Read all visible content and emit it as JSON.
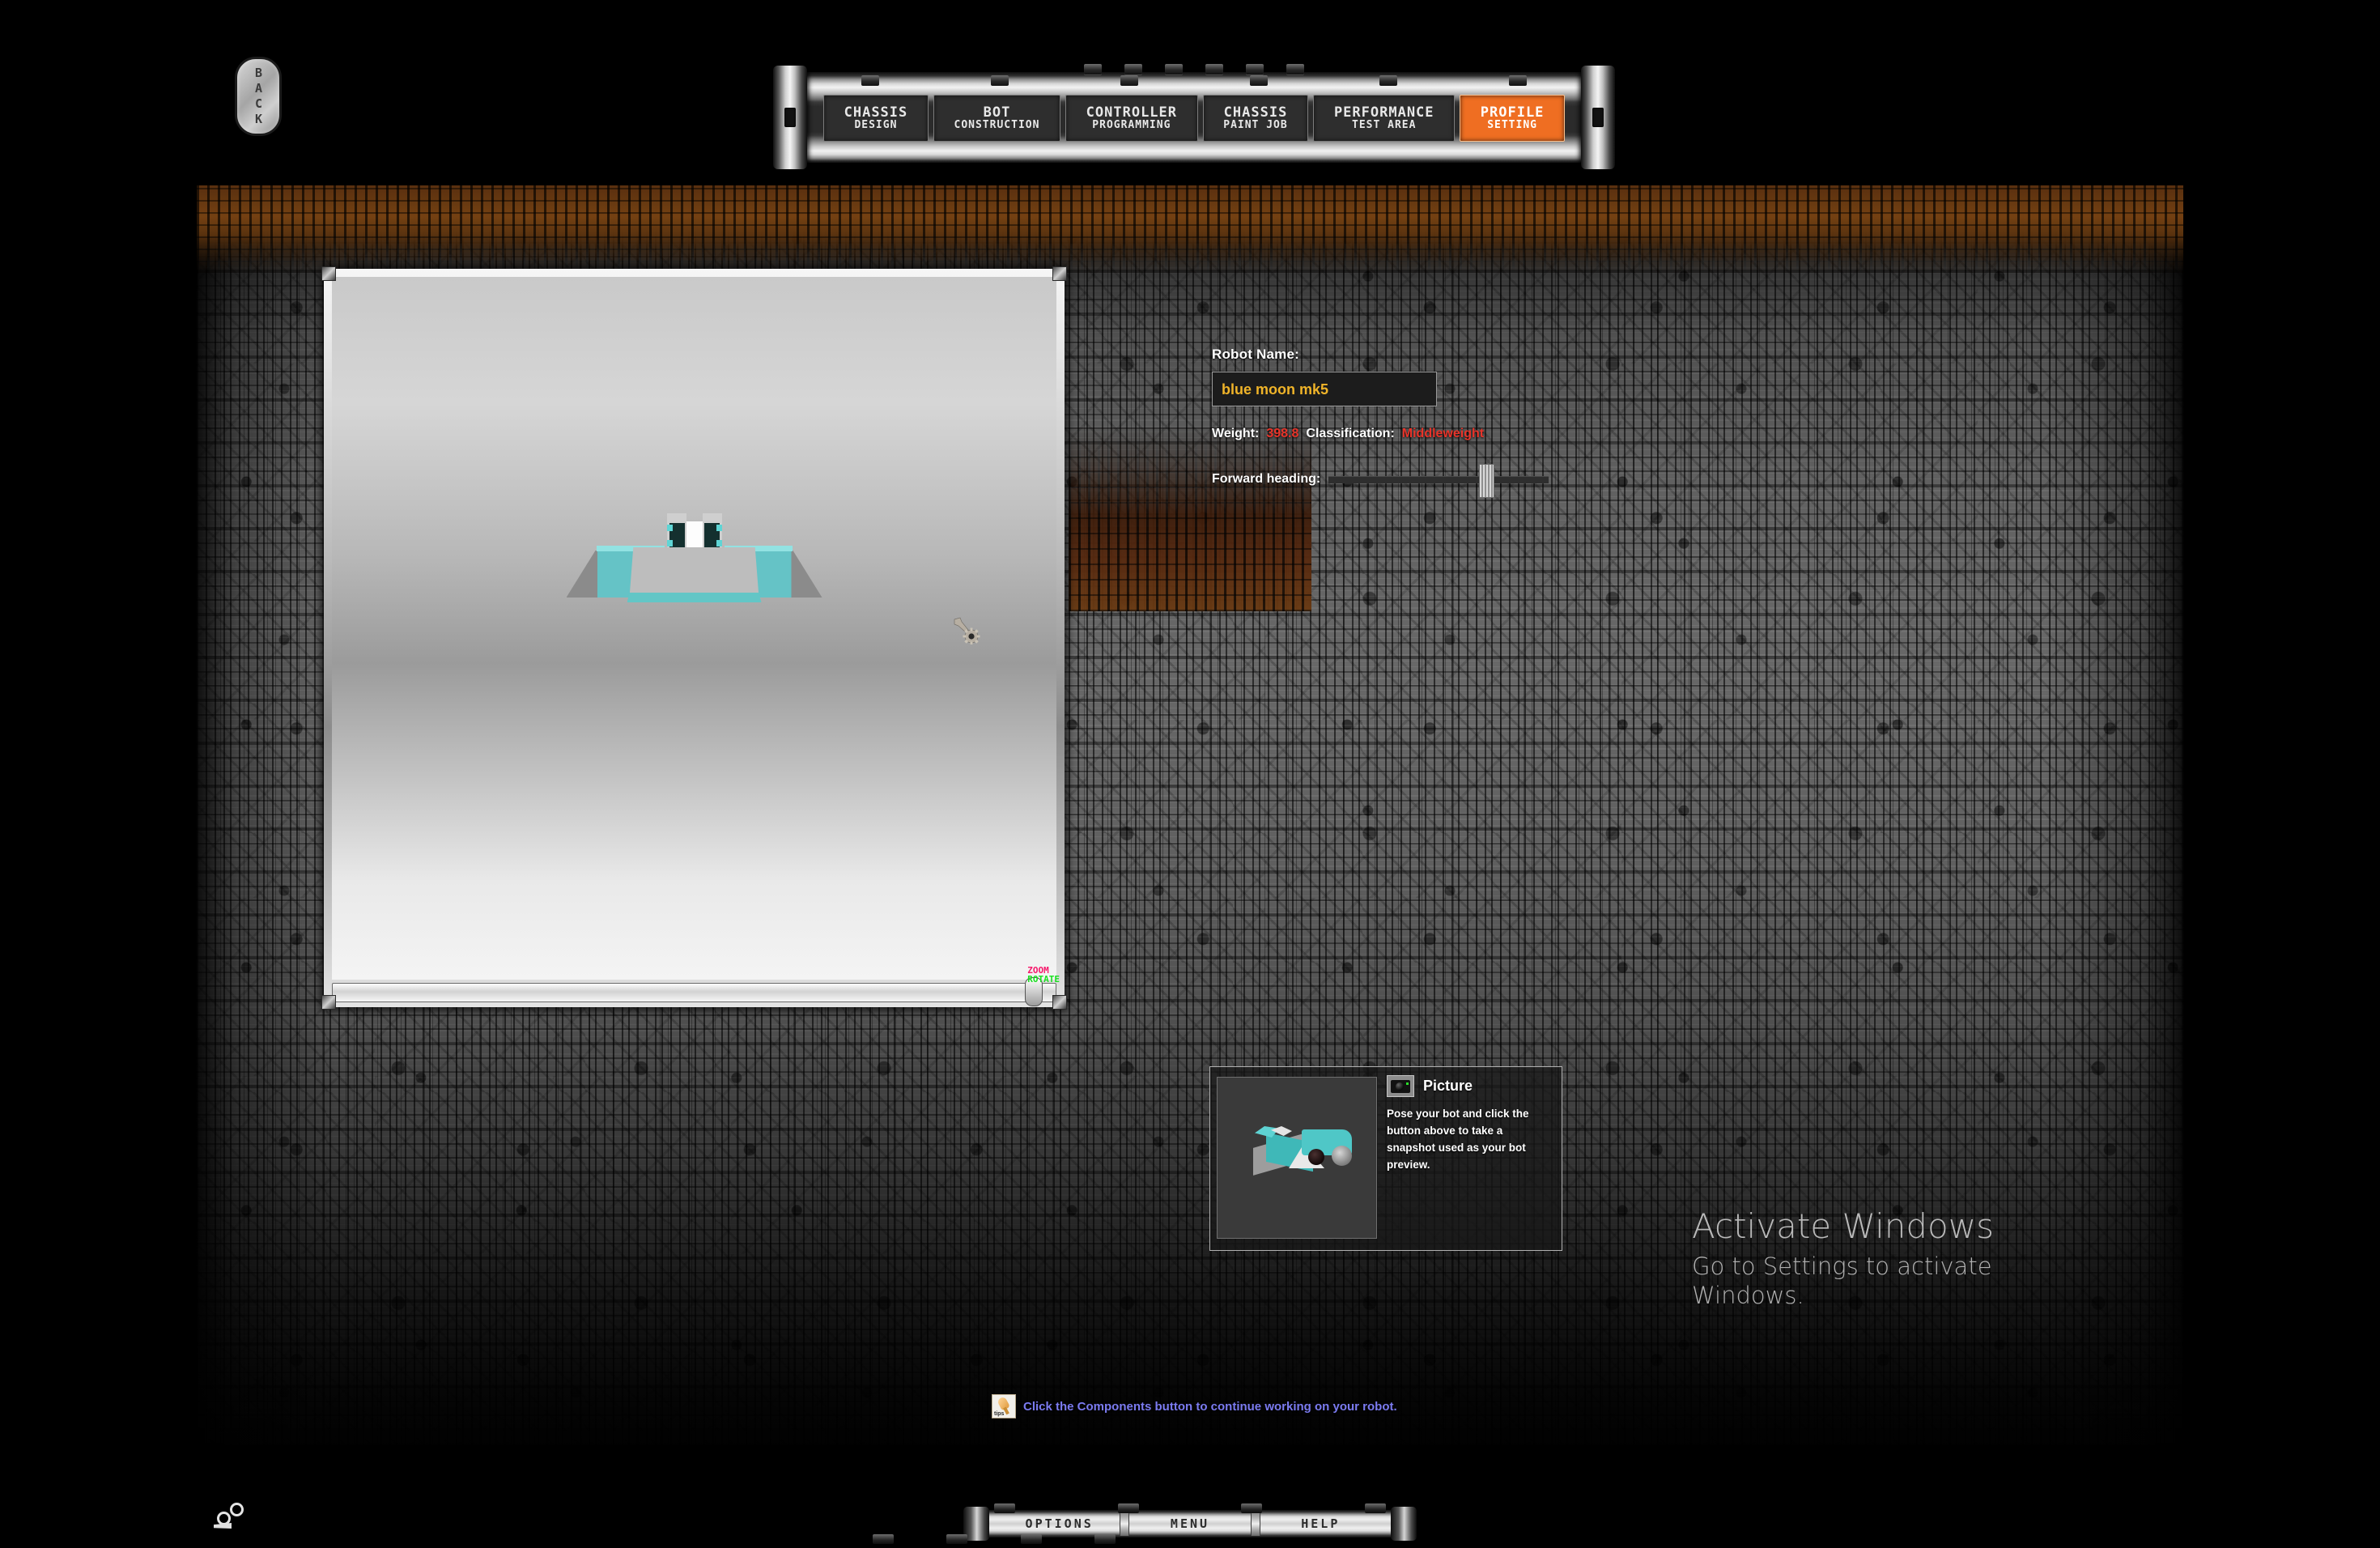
{
  "nav": {
    "back_label": "BACK",
    "tabs": [
      {
        "line1": "CHASSIS",
        "line2": "DESIGN",
        "active": false
      },
      {
        "line1": "BOT",
        "line2": "CONSTRUCTION",
        "active": false
      },
      {
        "line1": "CONTROLLER",
        "line2": "PROGRAMMING",
        "active": false
      },
      {
        "line1": "CHASSIS",
        "line2": "PAINT JOB",
        "active": false
      },
      {
        "line1": "PERFORMANCE",
        "line2": "TEST AREA",
        "active": false
      },
      {
        "line1": "PROFILE",
        "line2": "SETTING",
        "active": true
      }
    ],
    "active_color": "#ef6e22"
  },
  "viewport": {
    "hint_zoom": "ZOOM",
    "hint_rotate": "ROTATE",
    "hint_zoom_color": "#f6186b",
    "hint_rotate_color": "#19e020"
  },
  "info": {
    "name_label": "Robot Name:",
    "name_value": "blue moon mk5",
    "name_value_color": "#f0b429",
    "weight_label": "Weight:",
    "weight_value": "398.8",
    "classification_label": "Classification:",
    "classification_value": "Middleweight",
    "stat_value_color": "#e8342a",
    "heading_label": "Forward heading:"
  },
  "picture": {
    "title": "Picture",
    "description": "Pose your bot and click the button above to take a snapshot used as your bot preview."
  },
  "watermark": {
    "line1": "Activate Windows",
    "line2": "Go to Settings to activate Windows."
  },
  "tipbar": {
    "icon_word": "tips",
    "text": "Click the Components button to continue working on your robot."
  },
  "bottom_menu": {
    "options": "OPTIONS",
    "menu": "MENU",
    "help": "HELP"
  }
}
